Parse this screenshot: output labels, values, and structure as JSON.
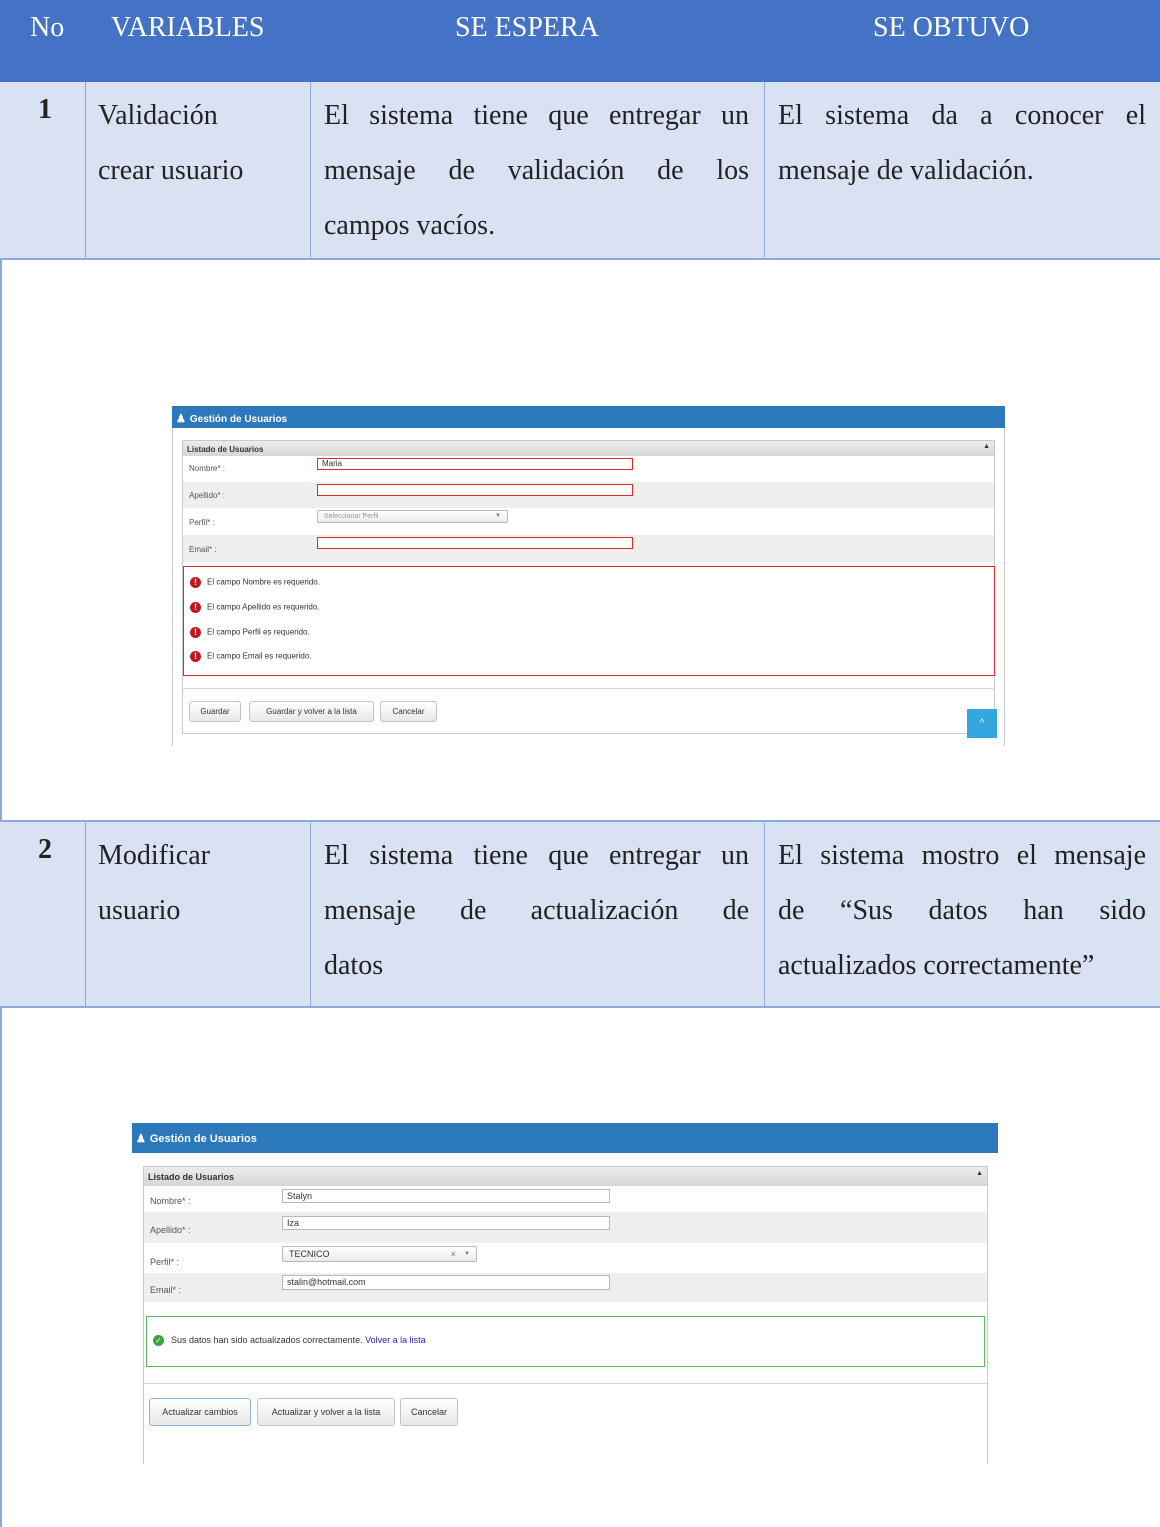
{
  "table": {
    "headers": {
      "no": "No",
      "variables": "VARIABLES",
      "expected": "SE ESPERA",
      "obtained": "SE OBTUVO"
    },
    "rows": [
      {
        "number": "1",
        "variable": [
          "Validación",
          "crear usuario"
        ],
        "expected": [
          "El sistema tiene que entregar un",
          "mensaje de validación de los",
          "campos vacíos."
        ],
        "obtained": [
          "El sistema da a conocer el",
          "mensaje de validación."
        ]
      },
      {
        "number": "2",
        "variable": [
          "Modificar",
          "usuario"
        ],
        "expected": [
          "El sistema tiene que entregar un",
          "mensaje de actualización de",
          "datos"
        ],
        "obtained": [
          "El sistema mostro el mensaje",
          "de “Sus datos han sido",
          "actualizados correctamente”"
        ]
      }
    ]
  },
  "screenshot1": {
    "app_title": "Gestión de Usuarios",
    "panel_title": "Listado de Usuarios",
    "collapse_glyph": "▲",
    "fields": {
      "nombre_label": "Nombre* :",
      "nombre_value": "Maria",
      "apellido_label": "Apellido* :",
      "apellido_value": "",
      "perfil_label": "Perfil* :",
      "perfil_placeholder": "Seleccionar Perfil",
      "email_label": "Email* :",
      "email_value": ""
    },
    "errors": [
      "El campo Nombre es requerido.",
      "El campo Apellido es requerido.",
      "El campo Perfil es requerido.",
      "El campo Email es requerido."
    ],
    "buttons": {
      "save": "Guardar",
      "save_back": "Guardar y volver a la lista",
      "cancel": "Cancelar"
    },
    "scroll_top_glyph": "^",
    "colors": {
      "title_bar": "#2b78bb",
      "error": "#e0282d"
    }
  },
  "screenshot2": {
    "app_title": "Gestión de Usuarios",
    "panel_title": "Listado de Usuarios",
    "collapse_glyph": "▲",
    "fields": {
      "nombre_label": "Nombre* :",
      "nombre_value": "Stalyn",
      "apellido_label": "Apellido* :",
      "apellido_value": "Iza",
      "perfil_label": "Perfil* :",
      "perfil_value": "TECNICO",
      "email_label": "Email* :",
      "email_value": "stalin@hotmail.com"
    },
    "success": {
      "message": "Sus datos han sido actualizados correctamente.",
      "link": "Volver a la lista"
    },
    "buttons": {
      "update": "Actualizar cambios",
      "update_back": "Actualizar y volver a la lista",
      "cancel": "Cancelar"
    },
    "colors": {
      "title_bar": "#2b78bb",
      "success": "#5cb85c",
      "link": "#2323c8"
    }
  },
  "colors": {
    "header_bg": "#4472c4",
    "row_bg": "#d9e2f3",
    "border": "#8eaadb"
  }
}
